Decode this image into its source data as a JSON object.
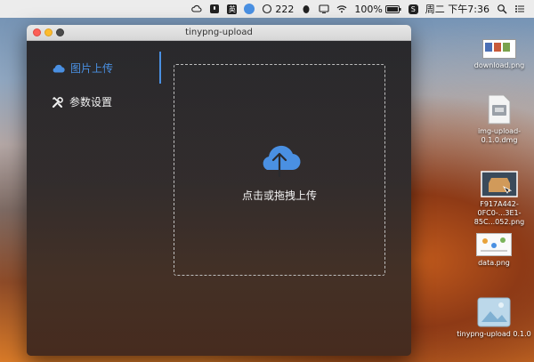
{
  "menubar": {
    "badge_text": "英",
    "notification_count": "222",
    "battery_percent": "100%",
    "datetime": "周二 下午7:36"
  },
  "window": {
    "title": "tinypng-upload"
  },
  "sidebar": {
    "items": [
      {
        "label": "图片上传",
        "icon": "cloud-icon",
        "active": true
      },
      {
        "label": "参数设置",
        "icon": "tools-icon",
        "active": false
      }
    ]
  },
  "dropzone": {
    "text": "点击或拖拽上传"
  },
  "desktop": {
    "icons": [
      {
        "label": "download.png"
      },
      {
        "label": "img-upload-0.1.0.dmg"
      },
      {
        "label": "F917A442-0FC0-...3E1-85C...052.png"
      },
      {
        "label": "data.png"
      },
      {
        "label": "tinypng-upload 0.1.0"
      }
    ]
  },
  "colors": {
    "accent": "#4a90e2",
    "close": "#fc5f57",
    "minimize": "#fdbc2e"
  }
}
